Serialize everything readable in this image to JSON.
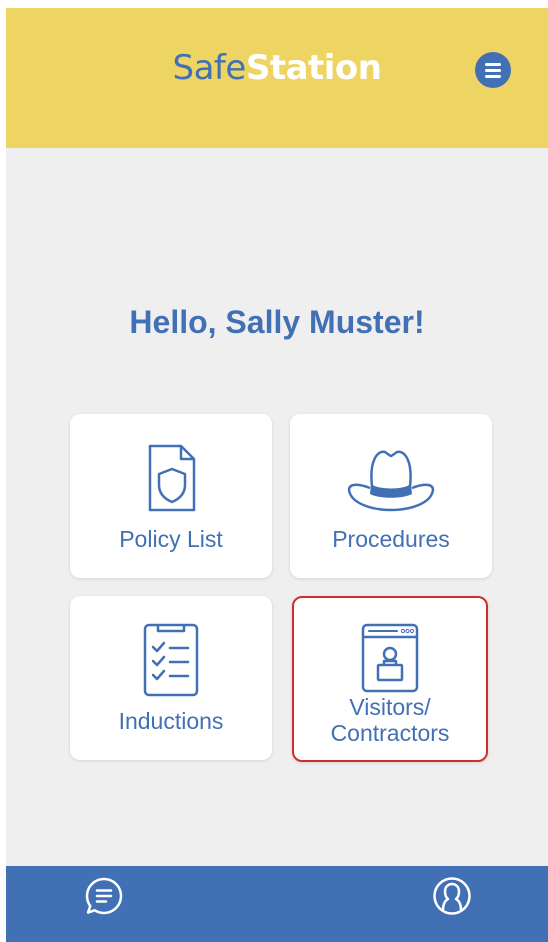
{
  "app": {
    "logo_part1": "Safe",
    "logo_part2": "Station"
  },
  "colors": {
    "header_bg": "#eed462",
    "brand_blue": "#4270b5",
    "background": "#efefef",
    "selection_outline": "#cc2f2f"
  },
  "header": {
    "menu_icon": "hamburger-menu-icon"
  },
  "main": {
    "greeting": "Hello, Sally Muster!",
    "tiles": [
      {
        "label": "Policy List",
        "icon": "shield-document-icon"
      },
      {
        "label": "Procedures",
        "icon": "hard-hat-icon"
      },
      {
        "label": "Inductions",
        "icon": "checklist-clipboard-icon"
      },
      {
        "label_line1": "Visitors/",
        "label_line2": "Contractors",
        "icon": "visitor-badge-icon"
      }
    ]
  },
  "footer": {
    "chat_icon": "chat-bubble-icon",
    "profile_icon": "user-profile-icon"
  }
}
